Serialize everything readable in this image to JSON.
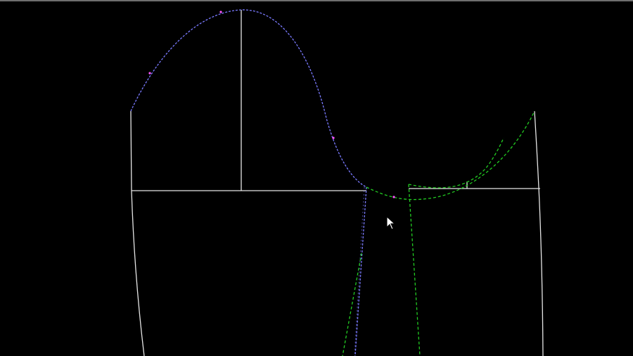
{
  "canvas": {
    "background": "#000000",
    "edge_color": "#6e6e6e"
  },
  "colors": {
    "solid_line": "#e6e6e6",
    "blue_dashed": "#7a7aff",
    "green_dashed": "#22cc22",
    "magenta_point": "#ff55ff",
    "cursor_fill": "#ffffff",
    "cursor_outline": "#000000"
  },
  "cursor": {
    "icon": "arrow-pointer-icon"
  }
}
